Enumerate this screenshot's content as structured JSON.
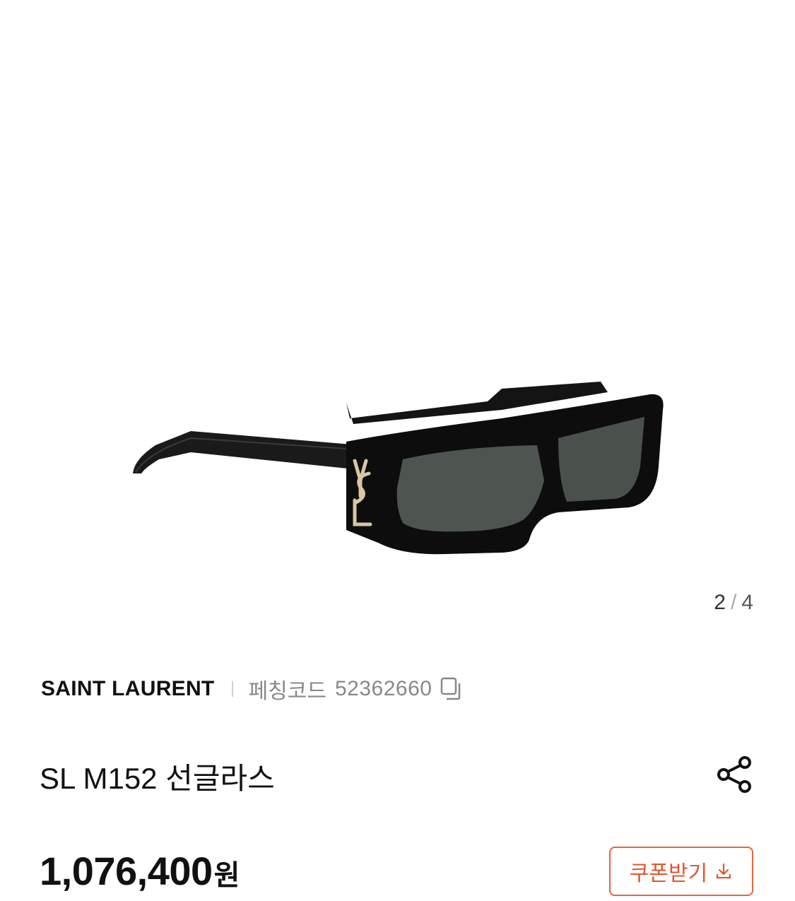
{
  "gallery": {
    "current": "2",
    "separator": "/",
    "total": "4"
  },
  "product": {
    "brand": "SAINT LAURENT",
    "code_label": "페칭코드",
    "code_value": "52362660",
    "title": "SL M152 선글라스",
    "price": "1,076,400",
    "currency": "원",
    "image_alt": "SL M152 sunglasses black frame with gold YSL logo"
  },
  "actions": {
    "coupon_label": "쿠폰받기"
  },
  "icons": {
    "copy": "copy-icon",
    "share": "share-icon",
    "download": "download-icon"
  },
  "colors": {
    "accent": "#e8663d",
    "muted_text": "#888888",
    "text": "#111111"
  }
}
